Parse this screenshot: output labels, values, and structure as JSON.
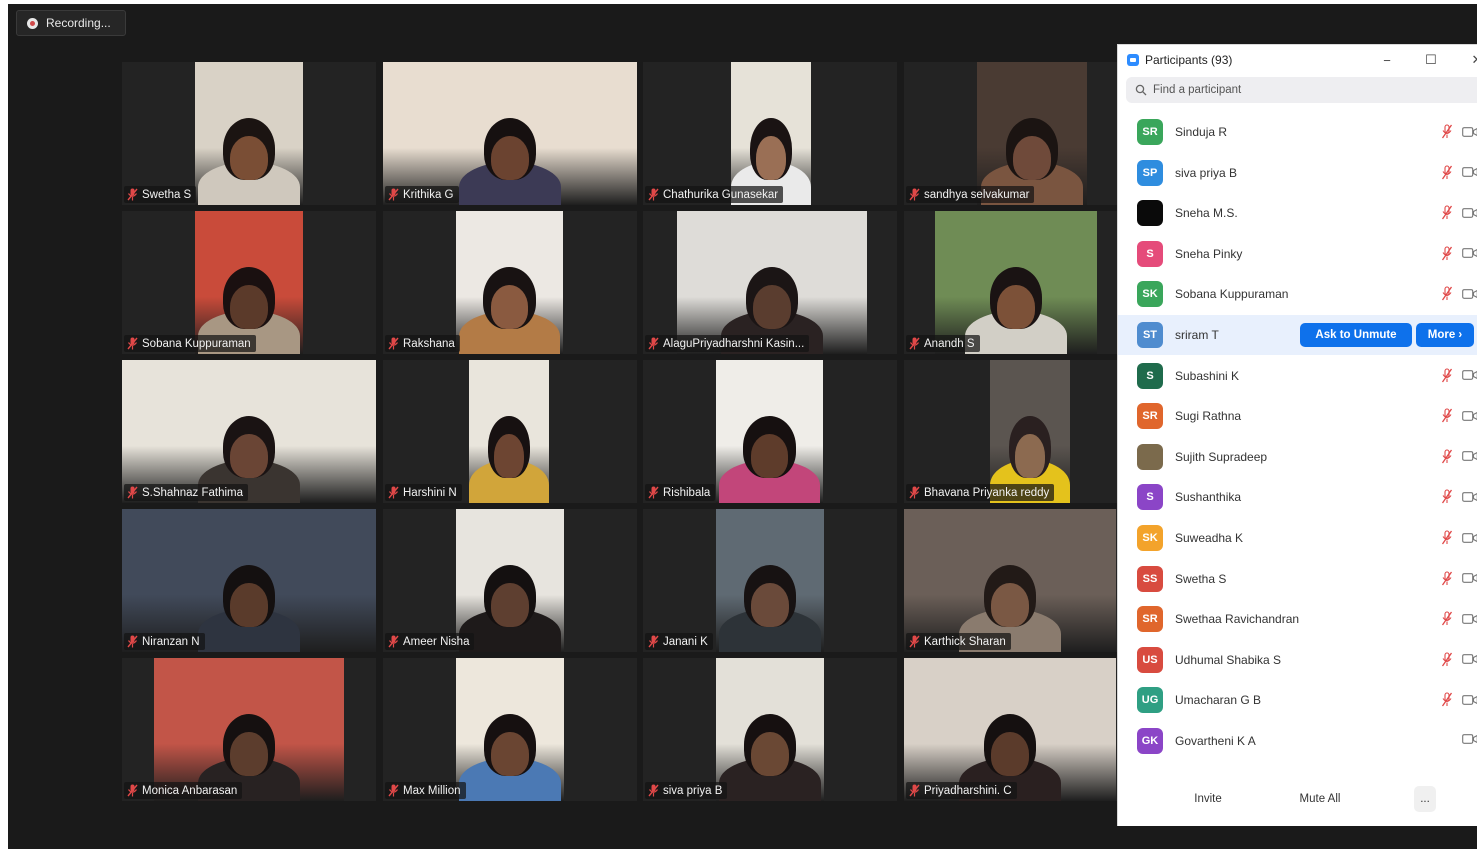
{
  "recording": {
    "label": "Recording..."
  },
  "colors": {
    "muted": "#e04848",
    "accent": "#0e71eb"
  },
  "tiles": [
    {
      "name": "Swetha S",
      "bg": "#d9d2c6",
      "skin": "#7a4e35",
      "hair": "#1b1412",
      "shirt": "#cfc8bd"
    },
    {
      "name": "Krithika G",
      "bg": "#e8ddd0",
      "skin": "#6b4330",
      "hair": "#161010",
      "shirt": "#3c3a55"
    },
    {
      "name": "Chathurika Gunasekar",
      "bg": "#e6e2d8",
      "skin": "#9a6f55",
      "hair": "#1a1313",
      "shirt": "#eaeaea"
    },
    {
      "name": "sandhya selvakumar",
      "bg": "#4a3b33",
      "skin": "#6f4a3a",
      "hair": "#1b1412",
      "shirt": "#7a5540"
    },
    {
      "name": "Sobana Kuppuraman",
      "bg": "#c94b3a",
      "skin": "#5b3a2a",
      "hair": "#1a1010",
      "shirt": "#a89783"
    },
    {
      "name": "Rakshana",
      "bg": "#ece8e3",
      "skin": "#8a5a40",
      "hair": "#181212",
      "shirt": "#b37b46"
    },
    {
      "name": "AlaguPriyadharshni Kasin...",
      "bg": "#dedcd8",
      "skin": "#5a3d2f",
      "hair": "#1b1515",
      "shirt": "#2a2222"
    },
    {
      "name": "Anandh S",
      "bg": "#6f8c55",
      "skin": "#7c5138",
      "hair": "#1a1313",
      "shirt": "#d2cfc6"
    },
    {
      "name": "S.Shahnaz Fathima",
      "bg": "#e7e3da",
      "skin": "#6a4535",
      "hair": "#1a1313",
      "shirt": "#3a3430"
    },
    {
      "name": "Harshini N",
      "bg": "#e9e5dc",
      "skin": "#6d4532",
      "hair": "#171111",
      "shirt": "#d1a53a"
    },
    {
      "name": "Rishibala",
      "bg": "#efede8",
      "skin": "#5e3c2b",
      "hair": "#161010",
      "shirt": "#c2467a"
    },
    {
      "name": "Bhavana Priyanka reddy",
      "bg": "#5b5550",
      "skin": "#8c6a50",
      "hair": "#2a2020",
      "shirt": "#e4c21c"
    },
    {
      "name": "Niranzan N",
      "bg": "#414a5a",
      "skin": "#5a3b2b",
      "hair": "#141010",
      "shirt": "#2e3440"
    },
    {
      "name": "Ameer Nisha",
      "bg": "#e7e4de",
      "skin": "#5e3f30",
      "hair": "#141010",
      "shirt": "#1e1a1a"
    },
    {
      "name": "Janani K",
      "bg": "#5f6a73",
      "skin": "#6a4a3a",
      "hair": "#171212",
      "shirt": "#2d3338"
    },
    {
      "name": "Karthick Sharan",
      "bg": "#6b5f58",
      "skin": "#7a5844",
      "hair": "#221a17",
      "shirt": "#8a7b6e"
    },
    {
      "name": "Monica Anbarasan",
      "bg": "#c25548",
      "skin": "#5c3d2d",
      "hair": "#151010",
      "shirt": "#282222"
    },
    {
      "name": "Max Million",
      "bg": "#ede7dc",
      "skin": "#6a4532",
      "hair": "#161010",
      "shirt": "#4b79b4"
    },
    {
      "name": "siva priya B",
      "bg": "#e3e0d8",
      "skin": "#6a4834",
      "hair": "#161010",
      "shirt": "#2a2222"
    },
    {
      "name": "Priyadharshini. C",
      "bg": "#d8d0c7",
      "skin": "#5b3b2b",
      "hair": "#151010",
      "shirt": "#2a2020"
    }
  ],
  "panel": {
    "title": "Participants (93)",
    "minimize": "−",
    "maximize": "☐",
    "close": "✕",
    "search_placeholder": "Find a participant",
    "participants": [
      {
        "initials": "SR",
        "name": "Sinduja R",
        "color": "#3aa65b",
        "muted": true,
        "video_off": true
      },
      {
        "initials": "SP",
        "name": "siva priya B",
        "color": "#2f8ddf",
        "muted": true,
        "video_off": true
      },
      {
        "initials": "",
        "name": "Sneha M.S.",
        "color": "#0a0a0a",
        "muted": true,
        "video_off": true
      },
      {
        "initials": "S",
        "name": "Sneha Pinky",
        "color": "#e54b7a",
        "muted": true,
        "video_off": true
      },
      {
        "initials": "SK",
        "name": "Sobana Kuppuraman",
        "color": "#3aa65b",
        "muted": true,
        "video_off": true
      },
      {
        "initials": "ST",
        "name": "sriram T",
        "color": "#4f8ccf",
        "highlight": true
      },
      {
        "initials": "S",
        "name": "Subashini K",
        "color": "#1f6b4c",
        "muted": true,
        "video_off": true
      },
      {
        "initials": "SR",
        "name": "Sugi Rathna",
        "color": "#e0662c",
        "muted": true,
        "video_off": true
      },
      {
        "initials": "",
        "name": "Sujith Supradeep",
        "color": "#7b6a4c",
        "muted": true,
        "video_off": true
      },
      {
        "initials": "S",
        "name": "Sushanthika",
        "color": "#8b45c7",
        "muted": true,
        "video_off": true
      },
      {
        "initials": "SK",
        "name": "Suweadha K",
        "color": "#f3a32b",
        "muted": true,
        "video_off": true
      },
      {
        "initials": "SS",
        "name": "Swetha S",
        "color": "#d84b3f",
        "muted": true,
        "video_off": true
      },
      {
        "initials": "SR",
        "name": "Swethaa Ravichandran",
        "color": "#e0662c",
        "muted": true,
        "video_off": true
      },
      {
        "initials": "US",
        "name": "Udhumal Shabika S",
        "color": "#d84b3f",
        "muted": true,
        "video_off": true
      },
      {
        "initials": "UG",
        "name": "Umacharan G B",
        "color": "#2f9f83",
        "muted": true,
        "video_off": true
      },
      {
        "initials": "GK",
        "name": "Govartheni K A",
        "color": "#8b45c7",
        "muted": false,
        "video_off": true
      }
    ],
    "ask_to_unmute": "Ask to Unmute",
    "more": "More ›",
    "invite": "Invite",
    "mute_all": "Mute All",
    "overflow": "..."
  }
}
